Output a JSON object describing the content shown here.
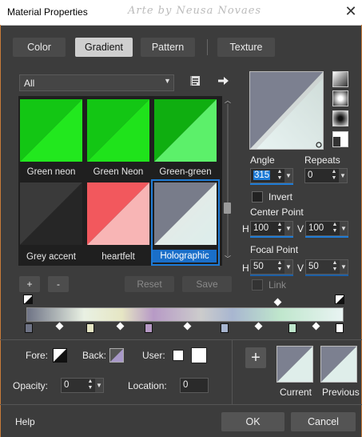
{
  "window": {
    "title": "Material Properties",
    "watermark": "Arte by Neusa Novaes",
    "close_glyph": "✕"
  },
  "tabs": [
    {
      "label": "Color",
      "active": false
    },
    {
      "label": "Gradient",
      "active": true
    },
    {
      "label": "Pattern",
      "active": false
    },
    {
      "label": "Texture",
      "active": false
    }
  ],
  "library": {
    "category": "All",
    "swatches": [
      {
        "name": "Green neon",
        "icon": "gradient-swatch"
      },
      {
        "name": "Green Neon",
        "icon": "gradient-swatch"
      },
      {
        "name": "Green-green",
        "icon": "gradient-swatch"
      },
      {
        "name": "Grey accent",
        "icon": "gradient-swatch"
      },
      {
        "name": "heartfelt",
        "icon": "gradient-swatch"
      },
      {
        "name": "Holographic",
        "icon": "gradient-swatch",
        "selected": true
      }
    ],
    "add_label": "+",
    "remove_label": "-",
    "reset_label": "Reset",
    "save_label": "Save"
  },
  "settings": {
    "angle_label": "Angle",
    "angle_value": "315",
    "repeats_label": "Repeats",
    "repeats_value": "0",
    "invert_label": "Invert",
    "invert_checked": false,
    "center_point_label": "Center Point",
    "center_h_label": "H",
    "center_h_value": "100",
    "center_v_label": "V",
    "center_v_value": "100",
    "focal_point_label": "Focal Point",
    "focal_h_label": "H",
    "focal_h_value": "50",
    "focal_v_label": "V",
    "focal_v_value": "50",
    "link_label": "Link"
  },
  "materials": {
    "fore_label": "Fore:",
    "back_label": "Back:",
    "user_label": "User:",
    "opacity_label": "Opacity:",
    "opacity_value": "0",
    "location_label": "Location:",
    "location_value": "0",
    "add_glyph": "+",
    "current_label": "Current",
    "previous_label": "Previous"
  },
  "footer": {
    "help_label": "Help",
    "ok_label": "OK",
    "cancel_label": "Cancel"
  },
  "colors": {
    "selection": "#1e7bd6",
    "panel": "#3c3c3c",
    "accent_border": "#c87b3a"
  }
}
